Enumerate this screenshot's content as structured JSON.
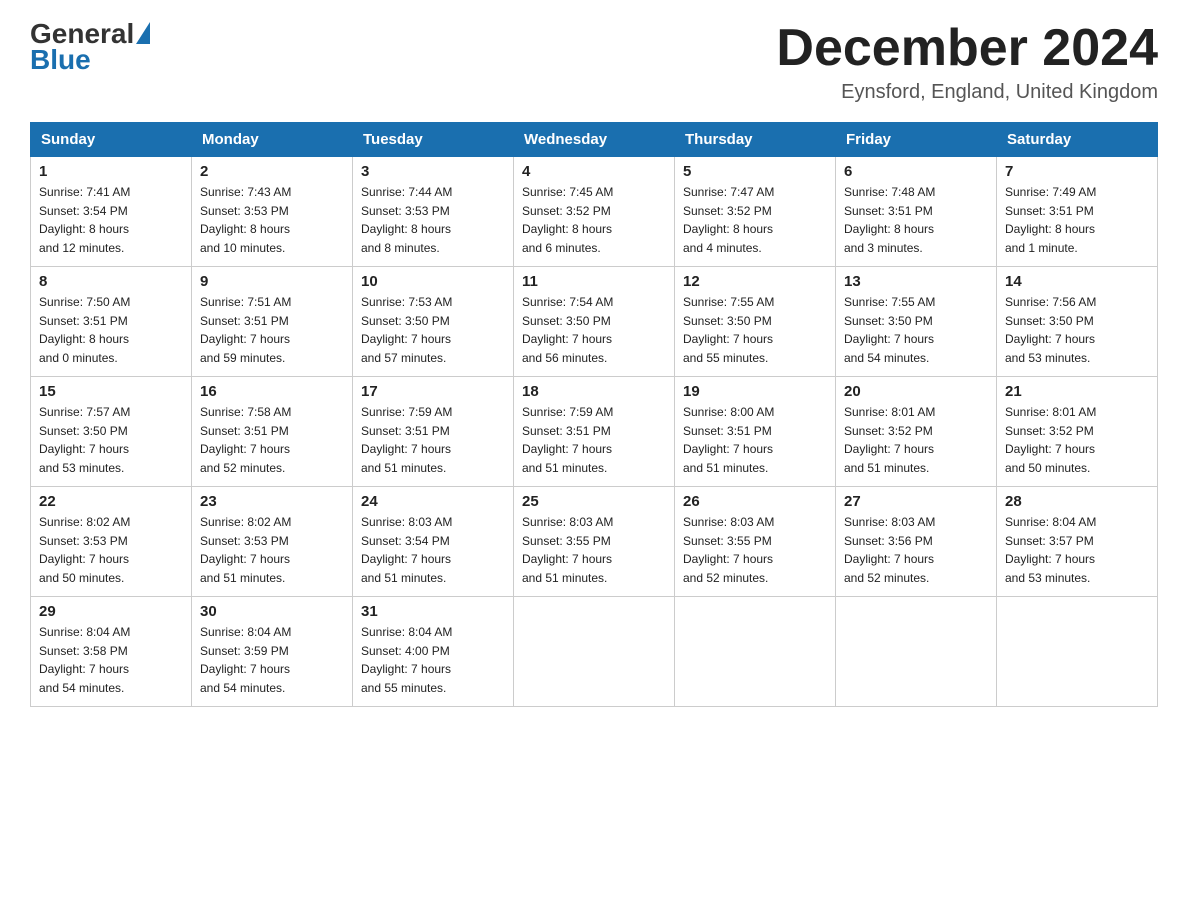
{
  "header": {
    "logo_general": "General",
    "logo_blue": "Blue",
    "month_title": "December 2024",
    "location": "Eynsford, England, United Kingdom"
  },
  "days_of_week": [
    "Sunday",
    "Monday",
    "Tuesday",
    "Wednesday",
    "Thursday",
    "Friday",
    "Saturday"
  ],
  "weeks": [
    [
      {
        "num": "1",
        "sunrise": "7:41 AM",
        "sunset": "3:54 PM",
        "daylight": "8 hours and 12 minutes."
      },
      {
        "num": "2",
        "sunrise": "7:43 AM",
        "sunset": "3:53 PM",
        "daylight": "8 hours and 10 minutes."
      },
      {
        "num": "3",
        "sunrise": "7:44 AM",
        "sunset": "3:53 PM",
        "daylight": "8 hours and 8 minutes."
      },
      {
        "num": "4",
        "sunrise": "7:45 AM",
        "sunset": "3:52 PM",
        "daylight": "8 hours and 6 minutes."
      },
      {
        "num": "5",
        "sunrise": "7:47 AM",
        "sunset": "3:52 PM",
        "daylight": "8 hours and 4 minutes."
      },
      {
        "num": "6",
        "sunrise": "7:48 AM",
        "sunset": "3:51 PM",
        "daylight": "8 hours and 3 minutes."
      },
      {
        "num": "7",
        "sunrise": "7:49 AM",
        "sunset": "3:51 PM",
        "daylight": "8 hours and 1 minute."
      }
    ],
    [
      {
        "num": "8",
        "sunrise": "7:50 AM",
        "sunset": "3:51 PM",
        "daylight": "8 hours and 0 minutes."
      },
      {
        "num": "9",
        "sunrise": "7:51 AM",
        "sunset": "3:51 PM",
        "daylight": "7 hours and 59 minutes."
      },
      {
        "num": "10",
        "sunrise": "7:53 AM",
        "sunset": "3:50 PM",
        "daylight": "7 hours and 57 minutes."
      },
      {
        "num": "11",
        "sunrise": "7:54 AM",
        "sunset": "3:50 PM",
        "daylight": "7 hours and 56 minutes."
      },
      {
        "num": "12",
        "sunrise": "7:55 AM",
        "sunset": "3:50 PM",
        "daylight": "7 hours and 55 minutes."
      },
      {
        "num": "13",
        "sunrise": "7:55 AM",
        "sunset": "3:50 PM",
        "daylight": "7 hours and 54 minutes."
      },
      {
        "num": "14",
        "sunrise": "7:56 AM",
        "sunset": "3:50 PM",
        "daylight": "7 hours and 53 minutes."
      }
    ],
    [
      {
        "num": "15",
        "sunrise": "7:57 AM",
        "sunset": "3:50 PM",
        "daylight": "7 hours and 53 minutes."
      },
      {
        "num": "16",
        "sunrise": "7:58 AM",
        "sunset": "3:51 PM",
        "daylight": "7 hours and 52 minutes."
      },
      {
        "num": "17",
        "sunrise": "7:59 AM",
        "sunset": "3:51 PM",
        "daylight": "7 hours and 51 minutes."
      },
      {
        "num": "18",
        "sunrise": "7:59 AM",
        "sunset": "3:51 PM",
        "daylight": "7 hours and 51 minutes."
      },
      {
        "num": "19",
        "sunrise": "8:00 AM",
        "sunset": "3:51 PM",
        "daylight": "7 hours and 51 minutes."
      },
      {
        "num": "20",
        "sunrise": "8:01 AM",
        "sunset": "3:52 PM",
        "daylight": "7 hours and 51 minutes."
      },
      {
        "num": "21",
        "sunrise": "8:01 AM",
        "sunset": "3:52 PM",
        "daylight": "7 hours and 50 minutes."
      }
    ],
    [
      {
        "num": "22",
        "sunrise": "8:02 AM",
        "sunset": "3:53 PM",
        "daylight": "7 hours and 50 minutes."
      },
      {
        "num": "23",
        "sunrise": "8:02 AM",
        "sunset": "3:53 PM",
        "daylight": "7 hours and 51 minutes."
      },
      {
        "num": "24",
        "sunrise": "8:03 AM",
        "sunset": "3:54 PM",
        "daylight": "7 hours and 51 minutes."
      },
      {
        "num": "25",
        "sunrise": "8:03 AM",
        "sunset": "3:55 PM",
        "daylight": "7 hours and 51 minutes."
      },
      {
        "num": "26",
        "sunrise": "8:03 AM",
        "sunset": "3:55 PM",
        "daylight": "7 hours and 52 minutes."
      },
      {
        "num": "27",
        "sunrise": "8:03 AM",
        "sunset": "3:56 PM",
        "daylight": "7 hours and 52 minutes."
      },
      {
        "num": "28",
        "sunrise": "8:04 AM",
        "sunset": "3:57 PM",
        "daylight": "7 hours and 53 minutes."
      }
    ],
    [
      {
        "num": "29",
        "sunrise": "8:04 AM",
        "sunset": "3:58 PM",
        "daylight": "7 hours and 54 minutes."
      },
      {
        "num": "30",
        "sunrise": "8:04 AM",
        "sunset": "3:59 PM",
        "daylight": "7 hours and 54 minutes."
      },
      {
        "num": "31",
        "sunrise": "8:04 AM",
        "sunset": "4:00 PM",
        "daylight": "7 hours and 55 minutes."
      },
      null,
      null,
      null,
      null
    ]
  ],
  "labels": {
    "sunrise": "Sunrise:",
    "sunset": "Sunset:",
    "daylight": "Daylight:"
  }
}
